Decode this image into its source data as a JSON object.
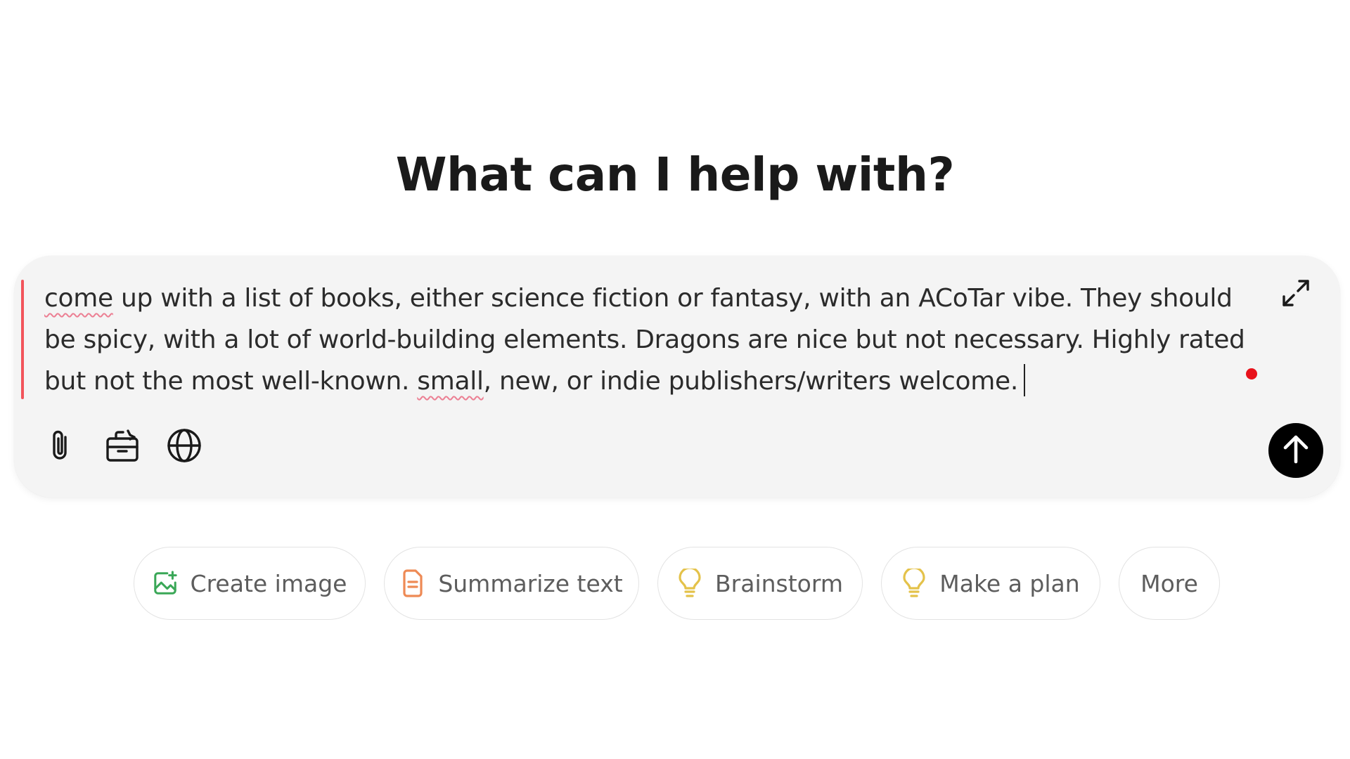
{
  "heading": "What can I help with?",
  "composer": {
    "prompt_before_1": "",
    "prompt_flag_1": "come",
    "prompt_mid": " up with a list of books, either science fiction or fantasy, with an ACoTar vibe. They should be spicy, with a lot of world-building elements. Dragons are nice but not necessary. Highly rated but not the most well-known. ",
    "prompt_flag_2": "small",
    "prompt_after": ", new, or indie publishers/writers welcome.",
    "tools": {
      "attach_icon": "paperclip-icon",
      "tools_icon": "toolbox-icon",
      "search_icon": "globe-icon",
      "expand_icon": "expand-arrows-icon",
      "send_icon": "arrow-up-icon"
    },
    "colors": {
      "background": "#f4f4f4",
      "focus_bar": "#f2545b",
      "spellcheck_underline": "#ec7f93",
      "recording_dot": "#e8121b",
      "send_button": "#000000"
    }
  },
  "suggestions": [
    {
      "label": "Create image",
      "icon": "image-sparkle-icon",
      "color": "#3aa757"
    },
    {
      "label": "Summarize text",
      "icon": "document-icon",
      "color": "#ee8a55"
    },
    {
      "label": "Brainstorm",
      "icon": "lightbulb-icon",
      "color": "#e4c24a"
    },
    {
      "label": "Make a plan",
      "icon": "lightbulb-icon",
      "color": "#e4c24a"
    },
    {
      "label": "More",
      "icon": "",
      "color": ""
    }
  ]
}
